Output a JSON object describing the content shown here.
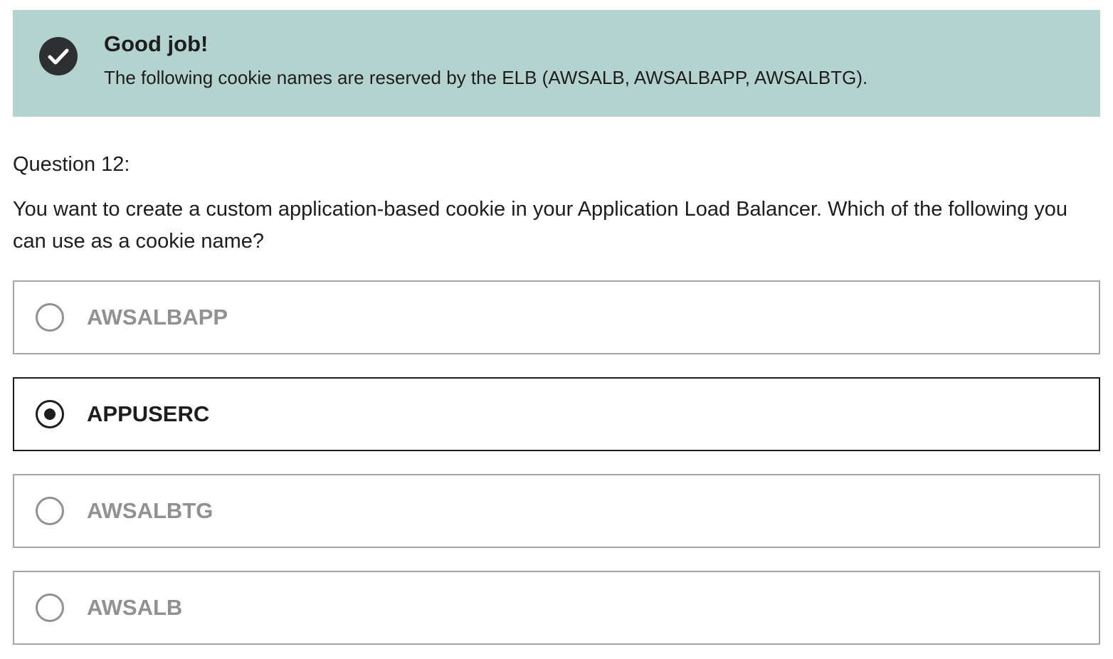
{
  "alert": {
    "icon": "check-circle-icon",
    "title": "Good job!",
    "message": "The following cookie names are reserved by the ELB (AWSALB, AWSALBAPP, AWSALBTG).",
    "background_color": "#b4d3ce"
  },
  "question": {
    "number_label": "Question 12:",
    "text": "You want to create a custom application-based cookie in your Application Load Balancer. Which of the following you can use as a cookie name?"
  },
  "options": [
    {
      "label": "AWSALBAPP",
      "selected": false
    },
    {
      "label": "APPUSERC",
      "selected": true
    },
    {
      "label": "AWSALBTG",
      "selected": false
    },
    {
      "label": "AWSALB",
      "selected": false
    }
  ],
  "colors": {
    "text_dark": "#1c1d1f",
    "text_muted": "#8f9193",
    "border_muted": "#a4a6a8"
  }
}
